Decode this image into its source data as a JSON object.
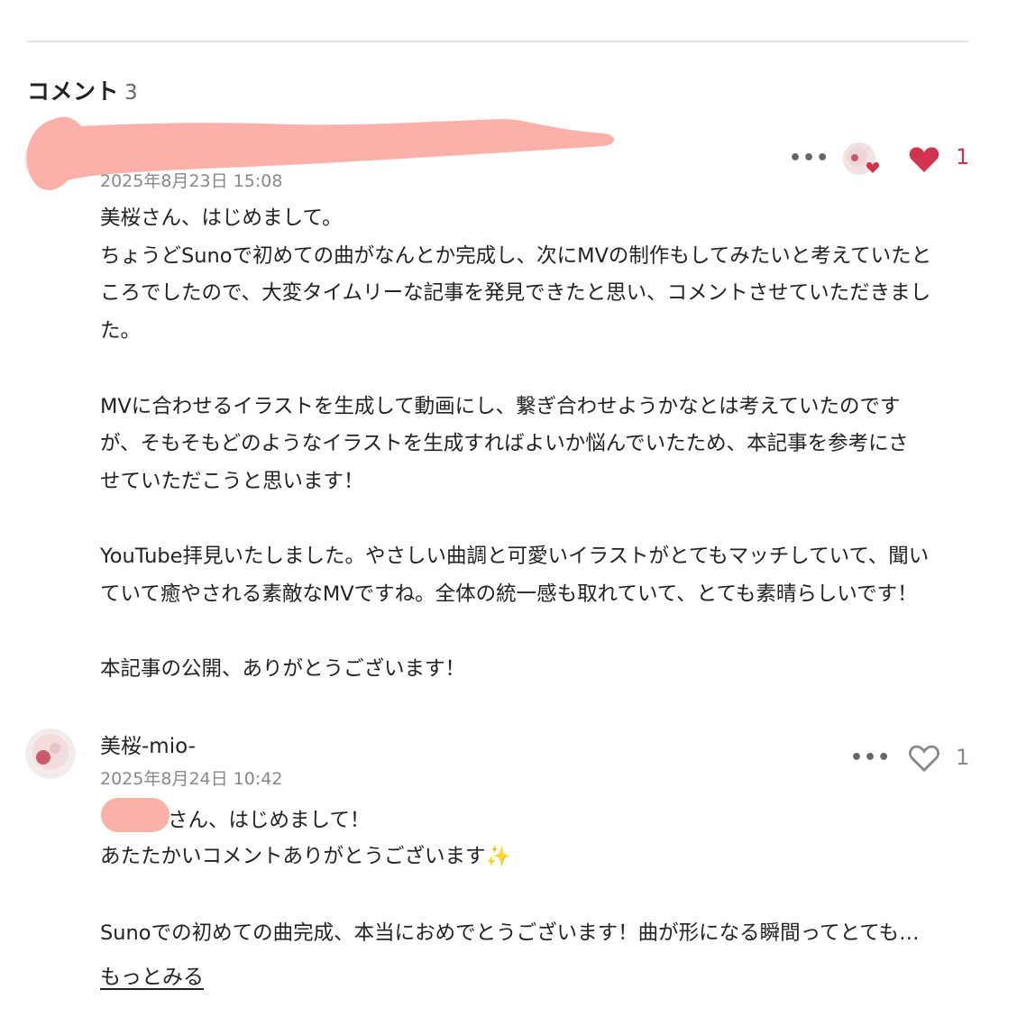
{
  "section": {
    "title": "コメント",
    "count": "3"
  },
  "comments": [
    {
      "user": "",
      "date": "2025年8月23日 15:08",
      "more_icon": "ellipsis-icon",
      "likes": "1",
      "liked": true,
      "like_color": "#d2334e",
      "body": "美桜さん、はじめまして。\nちょうどSunoで初めての曲がなんとか完成し、次にMVの制作もしてみたいと考えていたと\nころでしたので、大変タイムリーな記事を発見できたと思い、コメントさせていただきまし\nた。\n\nMVに合わせるイラストを生成して動画にし、繋ぎ合わせようかなとは考えていたのです\nが、そもそもどのようなイラストを生成すればよいか悩んでいたため、本記事を参考にさ\nせていただこうと思います！\n\nYouTube拝見いたしました。やさしい曲調と可愛いイラストがとてもマッチしていて、聞い\nていて癒やされる素敵なMVですね。全体の統一感も取れていて、とても素晴らしいです！\n\n本記事の公開、ありがとうございます！"
    },
    {
      "user": "美桜-mio-",
      "date": "2025年8月24日 10:42",
      "more_icon": "ellipsis-icon",
      "likes": "1",
      "liked": false,
      "body_line1": "さん、はじめまして！",
      "body_line2": "あたたかいコメントありがとうございます",
      "sparkle": "✨",
      "body_rest": "Sunoでの初めての曲完成、本当におめでとうございます！曲が形になる瞬間ってとても…",
      "read_more": "もっとみる"
    }
  ]
}
